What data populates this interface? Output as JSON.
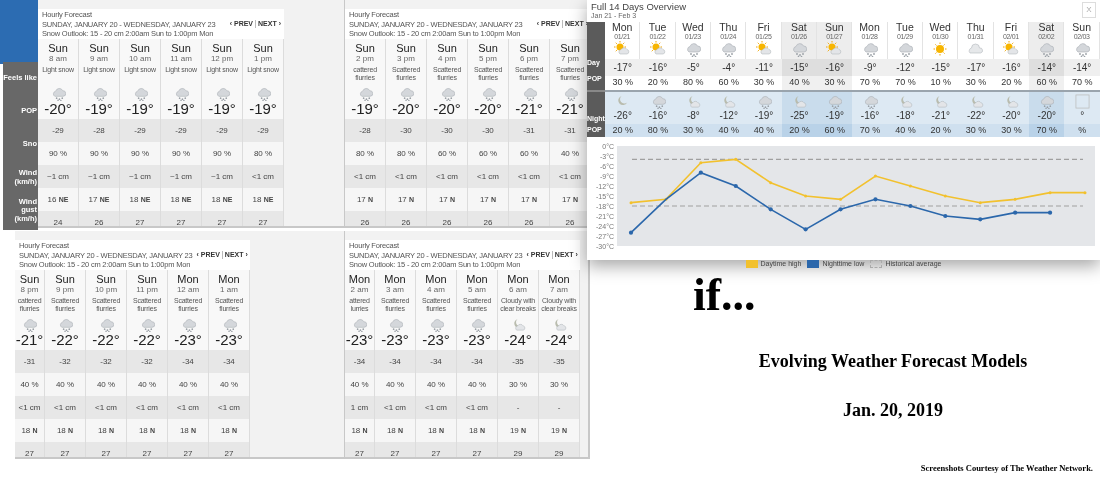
{
  "side_labels": {
    "rows": [
      "Feels like",
      "POP",
      "Sno",
      "Wind (km/h)",
      "Wind gust (km/h)"
    ]
  },
  "hourly_panels": [
    {
      "header": {
        "title": "Hourly Forecast",
        "dates": "SUNDAY, JANUARY 20 - WEDNESDAY, JANUARY 23",
        "outlook": "Snow Outlook: 15 - 20 cm 2:00am Sun to 1:00pm Mon",
        "prev": "‹ PREV",
        "next": "NEXT ›"
      },
      "columns": [
        {
          "cut": false,
          "day": "Sun",
          "time": "8 am",
          "condition": "Light snow",
          "temp": "-20°",
          "feels": "-29",
          "pop": "90 %",
          "snow": "~1 cm",
          "wind": "16",
          "dir": "NE",
          "gust": "24"
        },
        {
          "cut": false,
          "day": "Sun",
          "time": "9 am",
          "condition": "Light snow",
          "temp": "-19°",
          "feels": "-28",
          "pop": "90 %",
          "snow": "~1 cm",
          "wind": "17",
          "dir": "NE",
          "gust": "26"
        },
        {
          "cut": false,
          "day": "Sun",
          "time": "10 am",
          "condition": "Light snow",
          "temp": "-19°",
          "feels": "-29",
          "pop": "90 %",
          "snow": "~1 cm",
          "wind": "18",
          "dir": "NE",
          "gust": "27"
        },
        {
          "cut": false,
          "day": "Sun",
          "time": "11 am",
          "condition": "Light snow",
          "temp": "-19°",
          "feels": "-29",
          "pop": "90 %",
          "snow": "~1 cm",
          "wind": "18",
          "dir": "NE",
          "gust": "27"
        },
        {
          "cut": false,
          "day": "Sun",
          "time": "12 pm",
          "condition": "Light snow",
          "temp": "-19°",
          "feels": "-29",
          "pop": "90 %",
          "snow": "~1 cm",
          "wind": "18",
          "dir": "NE",
          "gust": "27"
        },
        {
          "cut": false,
          "day": "Sun",
          "time": "1 pm",
          "condition": "Light snow",
          "temp": "-19°",
          "feels": "-29",
          "pop": "80 %",
          "snow": "<1 cm",
          "wind": "18",
          "dir": "NE",
          "gust": "27"
        }
      ]
    },
    {
      "header": {
        "title": "Hourly Forecast",
        "dates": "SUNDAY, JANUARY 20 - WEDNESDAY, JANUARY 23",
        "outlook": "Snow Outlook: 15 - 20 cm 2:00am Sun to 1:00pm Mon",
        "prev": "‹ PREV",
        "next": "NEXT ›"
      },
      "columns": [
        {
          "cut": false,
          "day": "Sun",
          "time": "2 pm",
          "condition": "cattered flurries",
          "temp": "-19°",
          "feels": "-28",
          "pop": "80 %",
          "snow": "<1 cm",
          "wind": "17",
          "dir": "N",
          "gust": "26"
        },
        {
          "cut": false,
          "day": "Sun",
          "time": "3 pm",
          "condition": "Scattered flurries",
          "temp": "-20°",
          "feels": "-30",
          "pop": "80 %",
          "snow": "<1 cm",
          "wind": "17",
          "dir": "N",
          "gust": "26"
        },
        {
          "cut": false,
          "day": "Sun",
          "time": "4 pm",
          "condition": "Scattered flurries",
          "temp": "-20°",
          "feels": "-30",
          "pop": "60 %",
          "snow": "<1 cm",
          "wind": "17",
          "dir": "N",
          "gust": "26"
        },
        {
          "cut": false,
          "day": "Sun",
          "time": "5 pm",
          "condition": "Scattered flurries",
          "temp": "-20°",
          "feels": "-30",
          "pop": "60 %",
          "snow": "<1 cm",
          "wind": "17",
          "dir": "N",
          "gust": "26"
        },
        {
          "cut": false,
          "day": "Sun",
          "time": "6 pm",
          "condition": "Scattered flurries",
          "temp": "-21°",
          "feels": "-31",
          "pop": "60 %",
          "snow": "<1 cm",
          "wind": "17",
          "dir": "N",
          "gust": "26"
        },
        {
          "cut": false,
          "day": "Sun",
          "time": "7 pm",
          "condition": "Scattered flurries",
          "temp": "-21°",
          "feels": "-31",
          "pop": "40 %",
          "snow": "<1 cm",
          "wind": "17",
          "dir": "N",
          "gust": "26"
        }
      ]
    },
    {
      "header": {
        "title": "Hourly Forecast",
        "dates": "SUNDAY, JANUARY 20 - WEDNESDAY, JANUARY 23",
        "outlook": "Snow Outlook: 15 - 20 cm 2:00am Sun to 1:00pm Mon",
        "prev": "‹ PREV",
        "next": "NEXT ›"
      },
      "columns": [
        {
          "cut": true,
          "day": "Sun",
          "time": "8 pm",
          "condition": "cattered flurries",
          "temp": "-21°",
          "feels": "-31",
          "pop": "40 %",
          "snow": "<1 cm",
          "wind": "18",
          "dir": "N",
          "gust": "27"
        },
        {
          "cut": false,
          "day": "Sun",
          "time": "9 pm",
          "condition": "Scattered flurries",
          "temp": "-22°",
          "feels": "-32",
          "pop": "40 %",
          "snow": "<1 cm",
          "wind": "18",
          "dir": "N",
          "gust": "27"
        },
        {
          "cut": false,
          "day": "Sun",
          "time": "10 pm",
          "condition": "Scattered flurries",
          "temp": "-22°",
          "feels": "-32",
          "pop": "40 %",
          "snow": "<1 cm",
          "wind": "18",
          "dir": "N",
          "gust": "27"
        },
        {
          "cut": false,
          "day": "Sun",
          "time": "11 pm",
          "condition": "Scattered flurries",
          "temp": "-22°",
          "feels": "-32",
          "pop": "40 %",
          "snow": "<1 cm",
          "wind": "18",
          "dir": "N",
          "gust": "27"
        },
        {
          "cut": false,
          "day": "Mon",
          "time": "12 am",
          "condition": "Scattered flurries",
          "temp": "-23°",
          "feels": "-34",
          "pop": "40 %",
          "snow": "<1 cm",
          "wind": "18",
          "dir": "N",
          "gust": "27"
        },
        {
          "cut": false,
          "day": "Mon",
          "time": "1 am",
          "condition": "Scattered flurries",
          "temp": "-23°",
          "feels": "-34",
          "pop": "40 %",
          "snow": "<1 cm",
          "wind": "18",
          "dir": "N",
          "gust": "27"
        }
      ]
    },
    {
      "header": {
        "title": "Hourly Forecast",
        "dates": "SUNDAY, JANUARY 20 - WEDNESDAY, JANUARY 23",
        "outlook": "Snow Outlook: 15 - 20 cm 2:00am Sun to 1:00pm Mon",
        "prev": "‹ PREV",
        "next": "NEXT ›"
      },
      "columns": [
        {
          "cut": true,
          "day": "Mon",
          "time": "2 am",
          "condition": "attered lurries",
          "temp": "-23°",
          "feels": "-34",
          "pop": "40 %",
          "snow": "1 cm",
          "wind": "18",
          "dir": "N",
          "gust": "27"
        },
        {
          "cut": false,
          "day": "Mon",
          "time": "3 am",
          "condition": "Scattered flurries",
          "temp": "-23°",
          "feels": "-34",
          "pop": "40 %",
          "snow": "<1 cm",
          "wind": "18",
          "dir": "N",
          "gust": "27"
        },
        {
          "cut": false,
          "day": "Mon",
          "time": "4 am",
          "condition": "Scattered flurries",
          "temp": "-23°",
          "feels": "-34",
          "pop": "40 %",
          "snow": "<1 cm",
          "wind": "18",
          "dir": "N",
          "gust": "27"
        },
        {
          "cut": false,
          "day": "Mon",
          "time": "5 am",
          "condition": "Scattered flurries",
          "temp": "-23°",
          "feels": "-34",
          "pop": "40 %",
          "snow": "<1 cm",
          "wind": "18",
          "dir": "N",
          "gust": "27"
        },
        {
          "cut": false,
          "day": "Mon",
          "time": "6 am",
          "condition": "Cloudy with clear breaks",
          "temp": "-24°",
          "feels": "-35",
          "pop": "30 %",
          "snow": "-",
          "wind": "19",
          "dir": "N",
          "gust": "29"
        },
        {
          "cut": false,
          "day": "Mon",
          "time": "7 am",
          "condition": "Cloudy with clear breaks",
          "temp": "-24°",
          "feels": "-35",
          "pop": "30 %",
          "snow": "-",
          "wind": "19",
          "dir": "N",
          "gust": "29"
        }
      ]
    }
  ],
  "overview": {
    "title": "Full 14 Days Overview",
    "range": "Jan 21 - Feb 3",
    "close": "X",
    "labels": {
      "day": "Day",
      "day_pop": "POP",
      "night": "Night",
      "night_pop": "POP"
    },
    "days": [
      {
        "shaded": false,
        "day": "Mon",
        "date": "01/21",
        "high": "-17°",
        "day_pop": "30 %",
        "low": "-26°",
        "night_pop": "20 %"
      },
      {
        "shaded": false,
        "day": "Tue",
        "date": "01/22",
        "high": "-16°",
        "day_pop": "20 %",
        "low": "-16°",
        "night_pop": "80 %"
      },
      {
        "shaded": false,
        "day": "Wed",
        "date": "01/23",
        "high": "-5°",
        "day_pop": "80 %",
        "low": "-8°",
        "night_pop": "30 %"
      },
      {
        "shaded": false,
        "day": "Thu",
        "date": "01/24",
        "high": "-4°",
        "day_pop": "60 %",
        "low": "-12°",
        "night_pop": "40 %"
      },
      {
        "shaded": false,
        "day": "Fri",
        "date": "01/25",
        "high": "-11°",
        "day_pop": "30 %",
        "low": "-19°",
        "night_pop": "40 %"
      },
      {
        "shaded": true,
        "day": "Sat",
        "date": "01/26",
        "high": "-15°",
        "day_pop": "40 %",
        "low": "-25°",
        "night_pop": "20 %"
      },
      {
        "shaded": true,
        "day": "Sun",
        "date": "01/27",
        "high": "-16°",
        "day_pop": "30 %",
        "low": "-19°",
        "night_pop": "60 %"
      },
      {
        "shaded": false,
        "day": "Mon",
        "date": "01/28",
        "high": "-9°",
        "day_pop": "70 %",
        "low": "-16°",
        "night_pop": "70 %"
      },
      {
        "shaded": false,
        "day": "Tue",
        "date": "01/29",
        "high": "-12°",
        "day_pop": "70 %",
        "low": "-18°",
        "night_pop": "40 %"
      },
      {
        "shaded": false,
        "day": "Wed",
        "date": "01/30",
        "high": "-15°",
        "day_pop": "10 %",
        "low": "-21°",
        "night_pop": "20 %"
      },
      {
        "shaded": false,
        "day": "Thu",
        "date": "01/31",
        "high": "-17°",
        "day_pop": "30 %",
        "low": "-22°",
        "night_pop": "30 %"
      },
      {
        "shaded": false,
        "day": "Fri",
        "date": "02/01",
        "high": "-16°",
        "day_pop": "20 %",
        "low": "-20°",
        "night_pop": "30 %"
      },
      {
        "shaded": true,
        "day": "Sat",
        "date": "02/02",
        "high": "-14°",
        "day_pop": "60 %",
        "low": "-20°",
        "night_pop": "70 %"
      },
      {
        "shaded": false,
        "day": "Sun",
        "date": "02/03",
        "high": "-14°",
        "day_pop": "70 %",
        "low": "°",
        "night_pop": "%"
      }
    ],
    "chart_data": {
      "type": "line",
      "ylim": [
        -30,
        0
      ],
      "yticks": [
        {
          "value": 0,
          "label": "0°C"
        },
        {
          "value": -3,
          "label": "-3°C"
        },
        {
          "value": -6,
          "label": "-6°C"
        },
        {
          "value": -9,
          "label": "-9°C"
        },
        {
          "value": -12,
          "label": "-12°C"
        },
        {
          "value": -15,
          "label": "-15°C"
        },
        {
          "value": -18,
          "label": "-18°C"
        },
        {
          "value": -21,
          "label": "-21°C"
        },
        {
          "value": -24,
          "label": "-24°C"
        },
        {
          "value": -27,
          "label": "-27°C"
        },
        {
          "value": -30,
          "label": "-30°C"
        }
      ],
      "series": [
        {
          "name": "Daytime high",
          "color": "#f2c12e",
          "values": [
            -17,
            -16,
            -5,
            -4,
            -11,
            -15,
            -16,
            -9,
            -12,
            -15,
            -17,
            -16,
            -14,
            -14
          ]
        },
        {
          "name": "Nighttime low",
          "color": "#2b67ab",
          "values": [
            -26,
            -16,
            -8,
            -12,
            -19,
            -25,
            -19,
            -16,
            -18,
            -21,
            -22,
            -20,
            -20,
            null
          ]
        }
      ],
      "stacked": false
    },
    "average_label": "Historical average"
  },
  "slide": {
    "heading": "if...",
    "title": "Evolving Weather Forecast Models",
    "date": "Jan. 20, 2019",
    "credit": "Screenshots Courtesy of The Weather Network."
  }
}
